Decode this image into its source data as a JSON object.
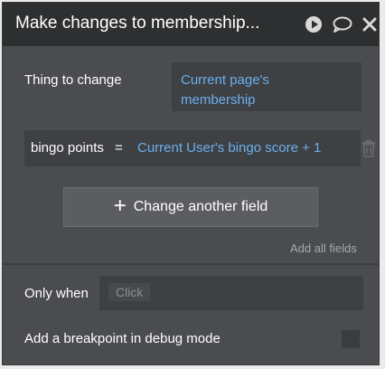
{
  "window": {
    "title": "Make changes to membership..."
  },
  "thing_to_change": {
    "label": "Thing to change",
    "value_line1": "Current page's",
    "value_line2": "membership"
  },
  "field": {
    "name": "bingo points",
    "operator": "=",
    "value": "Current User's bingo score + 1"
  },
  "buttons": {
    "change_another_field": "Change another field",
    "add_all_fields": "Add all fields"
  },
  "only_when": {
    "label": "Only when",
    "placeholder": "Click"
  },
  "breakpoint": {
    "label": "Add a breakpoint in debug mode",
    "checked": false
  },
  "icons": {
    "play": "play-icon",
    "comment": "comment-icon",
    "close": "close-icon",
    "trash": "trash-icon",
    "plus": "plus-icon"
  },
  "colors": {
    "panel_bg": "#4a4c4f",
    "titlebar_bg": "#2d2f31",
    "dynamic_text": "#6ab0ee",
    "muted_text": "#a6a8aa"
  }
}
